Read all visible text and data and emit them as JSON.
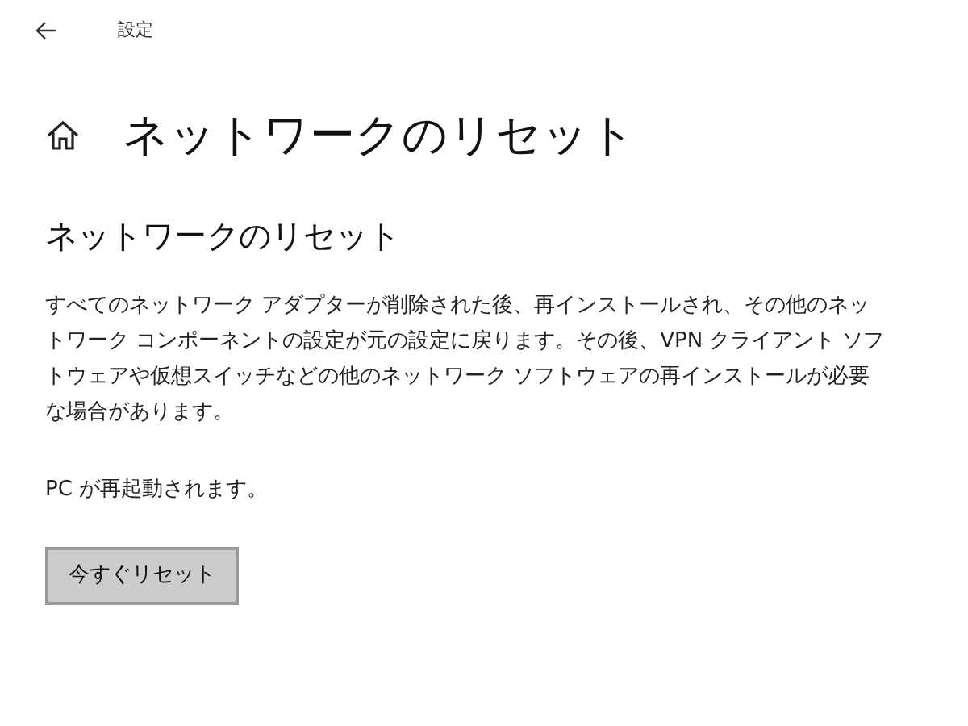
{
  "header": {
    "title": "設定"
  },
  "page": {
    "title": "ネットワークのリセット"
  },
  "section": {
    "heading": "ネットワークのリセット",
    "description": "すべてのネットワーク アダプターが削除された後、再インストールされ、その他のネットワーク コンポーネントの設定が元の設定に戻ります。その後、VPN クライアント ソフトウェアや仮想スイッチなどの他のネットワーク ソフトウェアの再インストールが必要な場合があります。",
    "note": "PC が再起動されます。",
    "button": "今すぐリセット"
  }
}
